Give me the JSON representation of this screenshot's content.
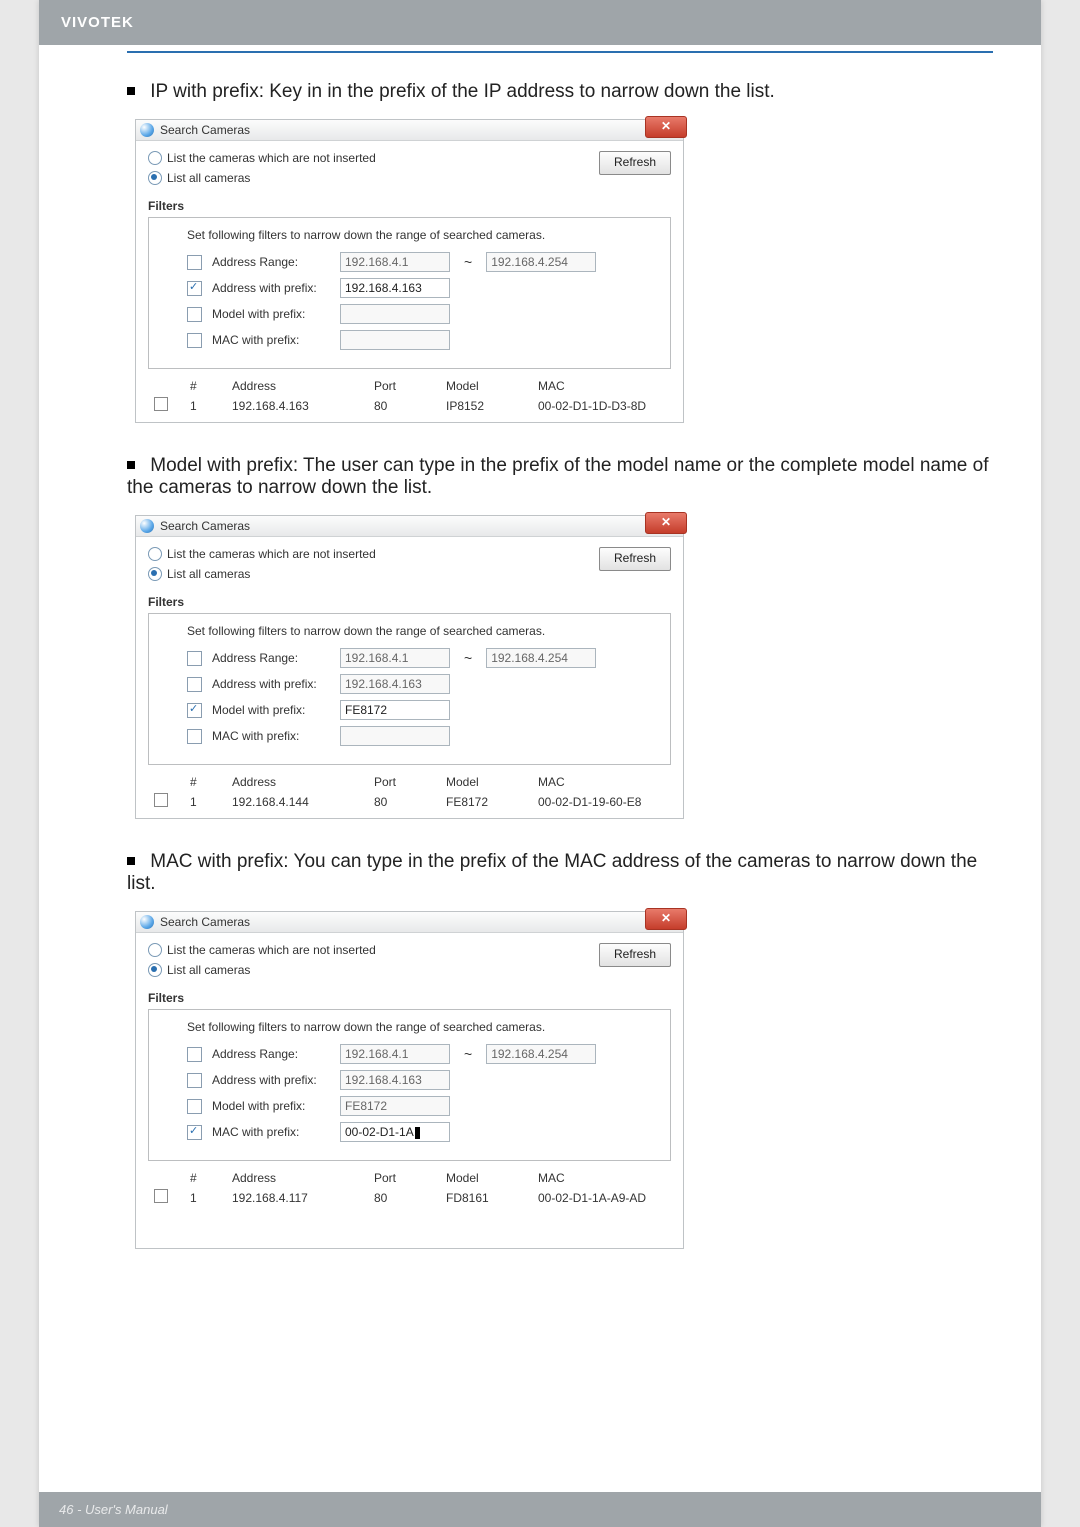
{
  "header_brand": "VIVOTEK",
  "footer_text": "46 - User's Manual",
  "bullets": {
    "ip_prefix": "IP with prefix: Key in in the prefix of the IP address to narrow down the list.",
    "model_prefix": "Model with prefix: The user can type in the prefix of the model name or the complete model name of the cameras to narrow down the list.",
    "mac_prefix": "MAC with prefix: You can type in the prefix of the MAC address of the cameras to narrow down the list."
  },
  "dialog_common": {
    "title": "Search Cameras",
    "opt_not_inserted": "List the cameras which are not inserted",
    "opt_all": "List all cameras",
    "refresh": "Refresh",
    "filters_heading": "Filters",
    "filters_desc": "Set following filters to narrow down the range of searched cameras.",
    "addr_range": "Address Range:",
    "addr_prefix": "Address with prefix:",
    "model_prefix": "Model with prefix:",
    "mac_prefix": "MAC with prefix:",
    "addr_from": "192.168.4.1",
    "addr_to": "192.168.4.254",
    "prefix_val": "192.168.4.163",
    "cols": {
      "num": "#",
      "addr": "Address",
      "port": "Port",
      "model": "Model",
      "mac": "MAC"
    }
  },
  "dialog1": {
    "model_value": "",
    "mac_value": "",
    "row": {
      "num": "1",
      "addr": "192.168.4.163",
      "port": "80",
      "model": "IP8152",
      "mac": "00-02-D1-1D-D3-8D"
    }
  },
  "dialog2": {
    "model_value": "FE8172",
    "mac_value": "",
    "row": {
      "num": "1",
      "addr": "192.168.4.144",
      "port": "80",
      "model": "FE8172",
      "mac": "00-02-D1-19-60-E8"
    }
  },
  "dialog3": {
    "model_value": "FE8172",
    "mac_value": "00-02-D1-1A",
    "row": {
      "num": "1",
      "addr": "192.168.4.117",
      "port": "80",
      "model": "FD8161",
      "mac": "00-02-D1-1A-A9-AD"
    }
  }
}
